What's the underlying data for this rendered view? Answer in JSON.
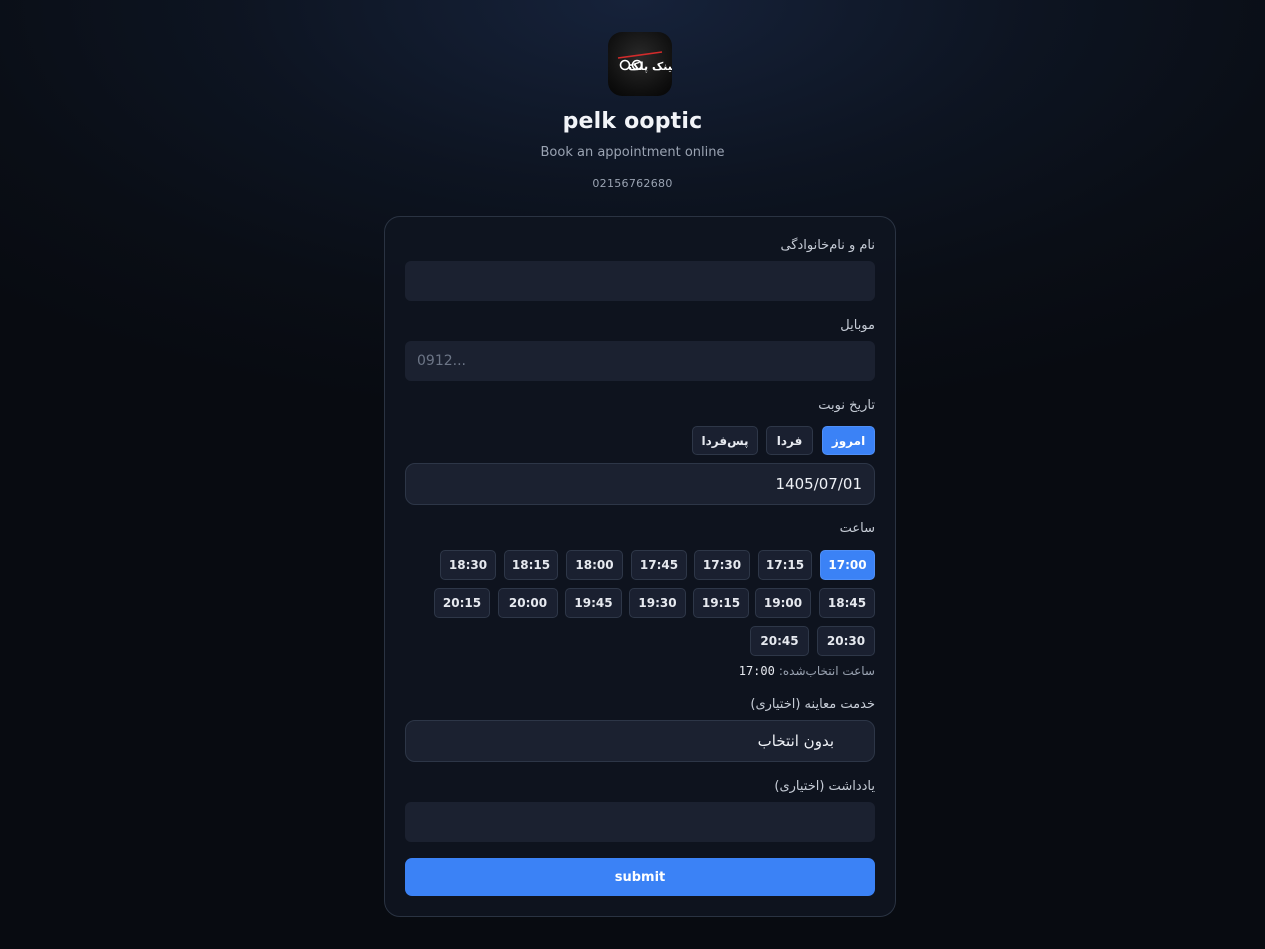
{
  "header": {
    "logo_text": "عینک پلک",
    "title": "pelk ooptic",
    "subtitle": "Book an appointment online",
    "phone": "02156762680"
  },
  "form": {
    "name": {
      "label": "نام و نام‌خانوادگی",
      "value": "",
      "placeholder": ""
    },
    "mobile": {
      "label": "موبایل",
      "value": "",
      "placeholder": "0912..."
    },
    "date": {
      "label": "تاریخ نوبت",
      "quick": [
        {
          "label": "امروز",
          "active": true
        },
        {
          "label": "فردا",
          "active": false
        },
        {
          "label": "پس‌فردا",
          "active": false
        }
      ],
      "value": "1405/07/01"
    },
    "time": {
      "label": "ساعت",
      "slots": [
        "17:00",
        "17:15",
        "17:30",
        "17:45",
        "18:00",
        "18:15",
        "18:30",
        "18:45",
        "19:00",
        "19:15",
        "19:30",
        "19:45",
        "20:00",
        "20:15",
        "20:30",
        "20:45"
      ],
      "selected_label": "ساعت انتخاب‌شده:",
      "selected_value": "17:00"
    },
    "service": {
      "label": "خدمت معاینه (اختیاری)",
      "value": "بدون انتخاب"
    },
    "note": {
      "label": "یادداشت (اختیاری)",
      "value": "",
      "placeholder": ""
    },
    "submit_label": "submit"
  },
  "colors": {
    "accent": "#3b82f6",
    "field_bg": "#1b2130",
    "card_border": "#2a3342"
  }
}
